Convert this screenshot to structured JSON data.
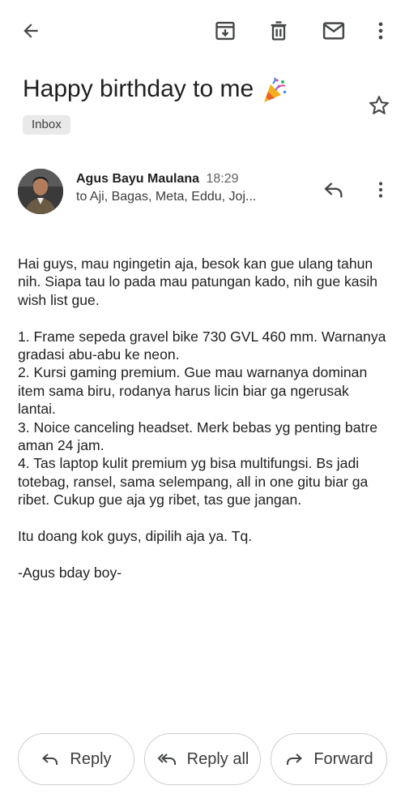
{
  "toolbar": {
    "back_icon": "arrow-left-icon",
    "archive_icon": "archive-icon",
    "delete_icon": "trash-icon",
    "mark_unread_icon": "mail-icon",
    "more_icon": "more-vertical-icon"
  },
  "email": {
    "subject": "Happy birthday to me",
    "subject_emoji_icon": "party-popper-icon",
    "label": "Inbox",
    "starred": false,
    "sender_name": "Agus Bayu Maulana",
    "time": "18:29",
    "recipients": "to Aji, Bagas, Meta, Eddu, Joj...",
    "body": [
      "Hai guys, mau ngingetin aja, besok kan gue ulang tahun nih. Siapa tau lo pada mau patungan kado, nih gue kasih wish list gue.",
      "",
      "1. Frame sepeda gravel bike 730 GVL 460 mm. Warnanya gradasi abu-abu ke neon.",
      "2. Kursi gaming premium. Gue mau warnanya dominan item sama biru, rodanya harus licin biar ga ngerusak lantai.",
      "3. Noice canceling headset. Merk bebas yg penting batre aman 24 jam.",
      "4. Tas laptop kulit premium yg bisa multifungsi. Bs jadi totebag, ransel, sama selempang, all in one gitu biar ga ribet. Cukup gue aja yg ribet, tas gue jangan.",
      "",
      "Itu doang kok guys, dipilih aja ya. Tq.",
      "",
      "-Agus bday boy-"
    ]
  },
  "actions": {
    "reply_label": "Reply",
    "reply_all_label": "Reply all",
    "forward_label": "Forward"
  },
  "colors": {
    "text": "#1f1f1f",
    "icon": "#444746",
    "chip_bg": "#e9e9e9",
    "button_border": "#cfcfcf"
  }
}
